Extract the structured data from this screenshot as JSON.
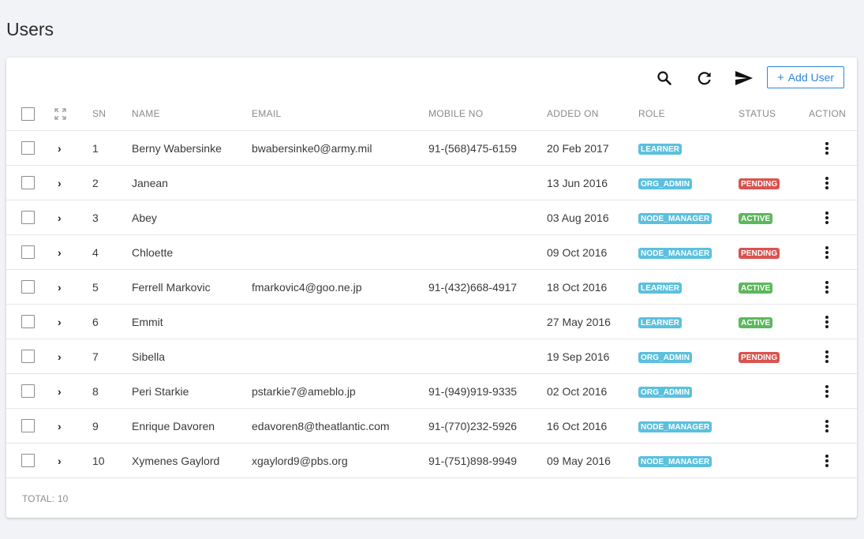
{
  "page": {
    "title": "Users"
  },
  "toolbar": {
    "search_icon": "search-icon",
    "refresh_icon": "refresh-icon",
    "send_icon": "send-icon",
    "add_user_plus": "+",
    "add_user_label": "Add User"
  },
  "columns": {
    "sn": "SN",
    "name": "NAME",
    "email": "EMAIL",
    "mobile": "MOBILE NO",
    "added_on": "ADDED ON",
    "role": "ROLE",
    "status": "STATUS",
    "action": "ACTION"
  },
  "colors": {
    "LEARNER": "#5bc0de",
    "ORG_ADMIN": "#5bc0de",
    "NODE_MANAGER": "#5bc0de",
    "PENDING": "#d9534f",
    "ACTIVE": "#5cb85c",
    "accent": "#2e86de"
  },
  "rows": [
    {
      "sn": "1",
      "name": "Berny Wabersinke",
      "email": "bwabersinke0@army.mil",
      "mobile": "91-(568)475-6159",
      "added_on": "20 Feb 2017",
      "role": "LEARNER",
      "status": ""
    },
    {
      "sn": "2",
      "name": "Janean",
      "email": "",
      "mobile": "",
      "added_on": "13 Jun 2016",
      "role": "ORG_ADMIN",
      "status": "PENDING"
    },
    {
      "sn": "3",
      "name": "Abey",
      "email": "",
      "mobile": "",
      "added_on": "03 Aug 2016",
      "role": "NODE_MANAGER",
      "status": "ACTIVE"
    },
    {
      "sn": "4",
      "name": "Chloette",
      "email": "",
      "mobile": "",
      "added_on": "09 Oct 2016",
      "role": "NODE_MANAGER",
      "status": "PENDING"
    },
    {
      "sn": "5",
      "name": "Ferrell Markovic",
      "email": "fmarkovic4@goo.ne.jp",
      "mobile": "91-(432)668-4917",
      "added_on": "18 Oct 2016",
      "role": "LEARNER",
      "status": "ACTIVE"
    },
    {
      "sn": "6",
      "name": "Emmit",
      "email": "",
      "mobile": "",
      "added_on": "27 May 2016",
      "role": "LEARNER",
      "status": "ACTIVE"
    },
    {
      "sn": "7",
      "name": "Sibella",
      "email": "",
      "mobile": "",
      "added_on": "19 Sep 2016",
      "role": "ORG_ADMIN",
      "status": "PENDING"
    },
    {
      "sn": "8",
      "name": "Peri Starkie",
      "email": "pstarkie7@ameblo.jp",
      "mobile": "91-(949)919-9335",
      "added_on": "02 Oct 2016",
      "role": "ORG_ADMIN",
      "status": ""
    },
    {
      "sn": "9",
      "name": "Enrique Davoren",
      "email": "edavoren8@theatlantic.com",
      "mobile": "91-(770)232-5926",
      "added_on": "16 Oct 2016",
      "role": "NODE_MANAGER",
      "status": ""
    },
    {
      "sn": "10",
      "name": "Xymenes Gaylord",
      "email": "xgaylord9@pbs.org",
      "mobile": "91-(751)898-9949",
      "added_on": "09 May 2016",
      "role": "NODE_MANAGER",
      "status": ""
    }
  ],
  "footer": {
    "total_label": "TOTAL:",
    "total_count": "10"
  }
}
